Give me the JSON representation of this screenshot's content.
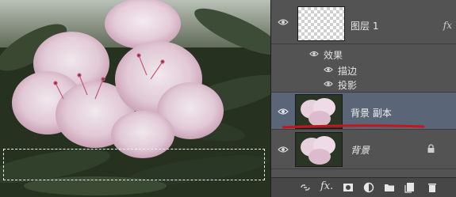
{
  "layers": [
    {
      "name": "图层 1",
      "fx_label": "fx",
      "effects_label": "效果",
      "effects": [
        "描边",
        "投影"
      ]
    },
    {
      "name": "背景 副本",
      "selected": true
    },
    {
      "name": "背景",
      "locked": true
    }
  ],
  "footer": {
    "icons": [
      "link-icon",
      "fx-icon",
      "mask-icon",
      "adjustment-icon",
      "folder-icon",
      "new-layer-icon",
      "trash-icon"
    ],
    "fx_label": "fx."
  },
  "colors": {
    "panel_bg": "#535353",
    "selected_row": "#5a6577",
    "underline_annotation": "#c4161c"
  }
}
